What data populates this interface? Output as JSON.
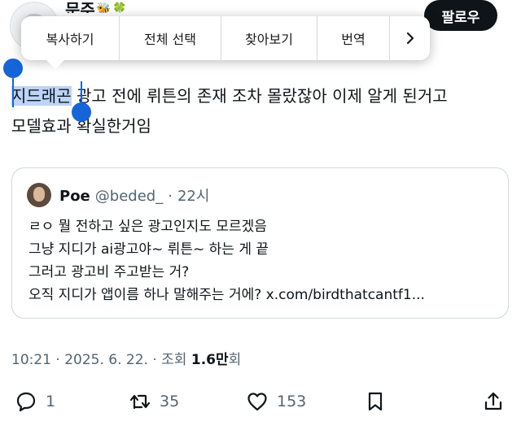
{
  "header": {
    "author_name": "문주",
    "author_emoji": "🐝",
    "author_clover": "🍀",
    "follow_label": "팔로우"
  },
  "context_menu": {
    "items": [
      "복사하기",
      "전체 선택",
      "찾아보기",
      "번역"
    ],
    "more_icon": "chevron-right-icon"
  },
  "tweet": {
    "line1_selected": "지드래곤",
    "line1_rest": " 광고 전에 뤼튼의 존재 조차 몰랐잖아 이제 알게 된거고",
    "line2": "모델효과 확실한거임"
  },
  "quote": {
    "name": "Poe",
    "handle": "@beded_",
    "dot": "·",
    "time": "22시",
    "lines": [
      "ㄹㅇ 뭘 전하고 싶은 광고인지도 모르겠음",
      "그냥 지디가 ai광고야~ 뤼튼~ 하는 게 끝",
      "그러고 광고비 주고받는 거?",
      "오직 지디가 앱이름 하나 말해주는 거에? x.com/birdthatcantf1..."
    ]
  },
  "meta": {
    "time": "10:21",
    "dot1": "·",
    "date": "2025. 6. 22.",
    "dot2": "·",
    "views_label": "조회",
    "views_number": "1.6만",
    "views_suffix": "회"
  },
  "actions": {
    "reply_count": "1",
    "retweet_count": "35",
    "like_count": "153"
  },
  "colors": {
    "selection": "#bcd4f7",
    "handle": "#1565d8",
    "muted": "#536471"
  }
}
